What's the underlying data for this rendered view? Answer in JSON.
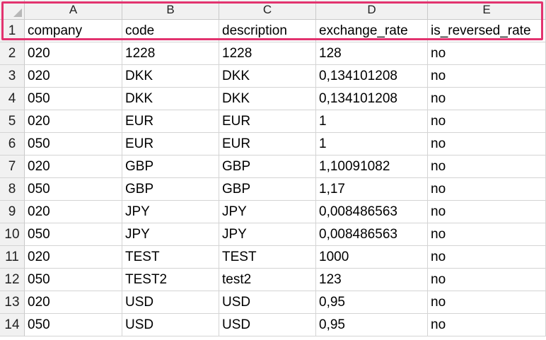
{
  "columns": [
    "A",
    "B",
    "C",
    "D",
    "E"
  ],
  "rows": [
    {
      "num": "1",
      "cells": [
        "company",
        "code",
        "description",
        "exchange_rate",
        "is_reversed_rate"
      ]
    },
    {
      "num": "2",
      "cells": [
        "020",
        "1228",
        "1228",
        "128",
        "no"
      ]
    },
    {
      "num": "3",
      "cells": [
        "020",
        "DKK",
        "DKK",
        "0,134101208",
        "no"
      ]
    },
    {
      "num": "4",
      "cells": [
        "050",
        "DKK",
        "DKK",
        "0,134101208",
        "no"
      ]
    },
    {
      "num": "5",
      "cells": [
        "020",
        "EUR",
        "EUR",
        "1",
        "no"
      ]
    },
    {
      "num": "6",
      "cells": [
        "050",
        "EUR",
        "EUR",
        "1",
        "no"
      ]
    },
    {
      "num": "7",
      "cells": [
        "020",
        "GBP",
        "GBP",
        "1,10091082",
        "no"
      ]
    },
    {
      "num": "8",
      "cells": [
        "050",
        "GBP",
        "GBP",
        "1,17",
        "no"
      ]
    },
    {
      "num": "9",
      "cells": [
        "020",
        "JPY",
        "JPY",
        "0,008486563",
        "no"
      ]
    },
    {
      "num": "10",
      "cells": [
        "050",
        "JPY",
        "JPY",
        "0,008486563",
        "no"
      ]
    },
    {
      "num": "11",
      "cells": [
        "020",
        "TEST",
        "TEST",
        "1000",
        "no"
      ]
    },
    {
      "num": "12",
      "cells": [
        "050",
        "TEST2",
        "test2",
        "123",
        "no"
      ]
    },
    {
      "num": "13",
      "cells": [
        "020",
        "USD",
        "USD",
        "0,95",
        "no"
      ]
    },
    {
      "num": "14",
      "cells": [
        "050",
        "USD",
        "USD",
        "0,95",
        "no"
      ]
    }
  ],
  "highlight_color": "#e2336f"
}
